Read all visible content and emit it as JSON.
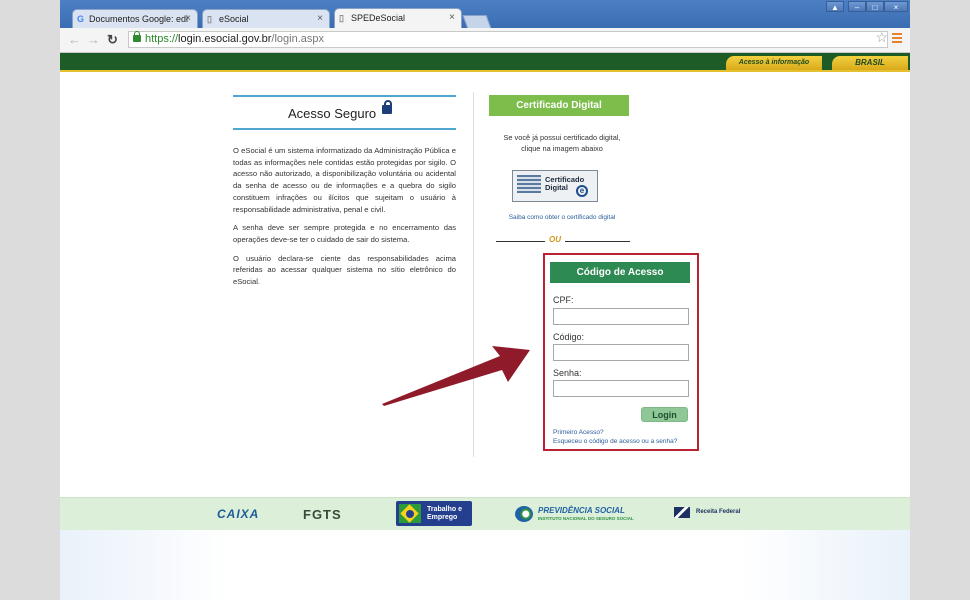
{
  "browser": {
    "tabs": [
      {
        "label": "Documentos Google: edi",
        "icon": "google-icon"
      },
      {
        "label": "eSocial",
        "icon": "page-icon"
      },
      {
        "label": "SPEDeSocial",
        "icon": "page-icon"
      }
    ],
    "url_scheme": "https://",
    "url_host": "login.esocial.gov.br",
    "url_path": "/login.aspx"
  },
  "govbar": {
    "acesso_informacao": "Acesso à informação",
    "brasil": "BRASIL",
    "color": "#1d5b27",
    "accent": "#e5c02f"
  },
  "acesso_seguro": {
    "title": "Acesso Seguro",
    "paragraphs": [
      "O eSocial é um sistema informatizado da Administração Pública e todas as informações nele contidas estão protegidas por sigilo. O acesso não autorizado, a disponibilização voluntária ou acidental da senha de acesso ou de informações e a quebra do sigilo constituem infrações ou ilícitos que sujeitam o usuário à responsabilidade administrativa, penal e civil.",
      "A senha deve ser sempre protegida e no encerramento das operações deve-se ter o cuidado de sair do sistema.",
      "O usuário declara-se ciente das responsabilidades acima referidas ao acessar qualquer sistema no sítio eletrônico do eSocial."
    ]
  },
  "certificado": {
    "header": "Certificado Digital",
    "help_line1": "Se você já possui certificado digital,",
    "help_line2": "clique na imagem abaixo",
    "logo_text_1": "Certificado",
    "logo_text_2": "Digital",
    "logo_e": "e",
    "link": "Saiba como obter o certificado digital",
    "color": "#7cbd4c"
  },
  "ou": "OU",
  "codigo_acesso": {
    "header": "Código de Acesso",
    "color": "#2e8a53",
    "border_color": "#b8232f",
    "cpf_label": "CPF:",
    "codigo_label": "Código:",
    "senha_label": "Senha:",
    "cpf_value": "",
    "codigo_value": "",
    "senha_value": "",
    "login_button": "Login",
    "primeiro_acesso": "Primeiro Acesso?",
    "esqueceu": "Esqueceu o código de acesso ou a senha?"
  },
  "footer": {
    "caixa": "CAIXA",
    "fgts": "FGTS",
    "mte": "Trabalho e Emprego",
    "previdencia": "PREVIDÊNCIA SOCIAL",
    "previdencia_sub": "INSTITUTO NACIONAL DO SEGURO SOCIAL",
    "receita": "Receita Federal"
  },
  "annotation_arrow_color": "#8f1b2a"
}
